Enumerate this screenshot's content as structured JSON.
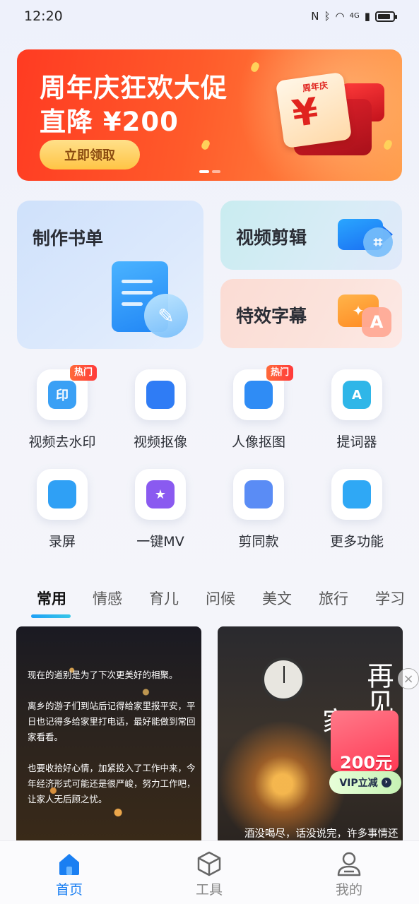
{
  "status_bar": {
    "time": "12:20",
    "icons": [
      "nfc-icon",
      "bluetooth-icon",
      "wifi-icon",
      "signal-icon",
      "battery-icon"
    ],
    "network_label": "4G"
  },
  "banner": {
    "title": "周年庆狂欢大促",
    "subtitle": "直降 ¥200",
    "button": "立即领取",
    "gift_label": "周年庆",
    "gift_symbol": "¥",
    "pages": 2,
    "active_page": 1
  },
  "features": {
    "make_booklist": "制作书单",
    "video_edit": "视频剪辑",
    "effect_subtitle": "特效字幕"
  },
  "tools": [
    {
      "label": "视频去水印",
      "badge": "热门",
      "icon": "watermark-icon",
      "glyph": "印",
      "color": "#3aa0f5"
    },
    {
      "label": "视频抠像",
      "badge": "",
      "icon": "matting-icon",
      "glyph": "",
      "color": "#2f7cf5"
    },
    {
      "label": "人像抠图",
      "badge": "热门",
      "icon": "portrait-icon",
      "glyph": "",
      "color": "#2f8cf5"
    },
    {
      "label": "提词器",
      "badge": "",
      "icon": "prompter-icon",
      "glyph": "A",
      "color": "#2fb6e8"
    },
    {
      "label": "录屏",
      "badge": "",
      "icon": "record-icon",
      "glyph": "",
      "color": "#2fa0f5"
    },
    {
      "label": "一键MV",
      "badge": "",
      "icon": "clapper-icon",
      "glyph": "★",
      "color": "#8a5af0"
    },
    {
      "label": "剪同款",
      "badge": "",
      "icon": "film-icon",
      "glyph": "",
      "color": "#5a8cf5"
    },
    {
      "label": "更多功能",
      "badge": "",
      "icon": "grid-icon",
      "glyph": "",
      "color": "#2fa8f5"
    }
  ],
  "tabs": [
    "常用",
    "情感",
    "育儿",
    "问候",
    "美文",
    "旅行",
    "学习"
  ],
  "active_tab": 0,
  "content_cards": {
    "left": {
      "paragraphs": [
        "现在的道别是为了下次更美好的相聚。",
        "离乡的游子们到站后记得给家里报平安，平日也记得多给家里打电话，最好能做到常回家看看。",
        "也要收拾好心情，加紧投入了工作中来，今年经济形式可能还是很严峻，努力工作吧，让家人无后顾之忧。"
      ]
    },
    "right": {
      "big_text": "再见",
      "big_text_partial": "家",
      "caption": "酒没喝尽，话没说完，许多事情还"
    }
  },
  "promo": {
    "amount": "200元",
    "button": "VIP立减",
    "close": "×"
  },
  "bottom_nav": [
    {
      "label": "首页",
      "icon": "home-icon",
      "active": true
    },
    {
      "label": "工具",
      "icon": "cube-icon",
      "active": false
    },
    {
      "label": "我的",
      "icon": "profile-icon",
      "active": false
    }
  ],
  "colors": {
    "accent": "#1a7ff2",
    "banner_red": "#ff3b22",
    "hot_badge": "#ff4a3a"
  }
}
